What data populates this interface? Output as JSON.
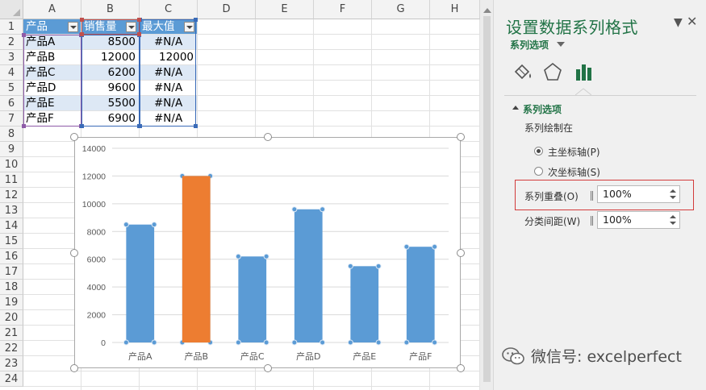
{
  "sheet": {
    "columns": [
      "A",
      "B",
      "C",
      "D",
      "E",
      "F",
      "G",
      "H"
    ],
    "rows": [
      "1",
      "2",
      "3",
      "4",
      "5",
      "6",
      "7",
      "8",
      "9",
      "10",
      "11",
      "12",
      "13",
      "14",
      "15",
      "16",
      "17",
      "18",
      "19",
      "20",
      "21",
      "22",
      "23",
      "24"
    ],
    "table": {
      "headers": [
        "产品",
        "销售量",
        "最大值"
      ],
      "rows": [
        [
          "产品A",
          "8500",
          "#N/A"
        ],
        [
          "产品B",
          "12000",
          "12000"
        ],
        [
          "产品C",
          "6200",
          "#N/A"
        ],
        [
          "产品D",
          "9600",
          "#N/A"
        ],
        [
          "产品E",
          "5500",
          "#N/A"
        ],
        [
          "产品F",
          "6900",
          "#N/A"
        ]
      ]
    }
  },
  "chart_data": {
    "type": "bar",
    "categories": [
      "产品A",
      "产品B",
      "产品C",
      "产品D",
      "产品E",
      "产品F"
    ],
    "series": [
      {
        "values": [
          8500,
          12000,
          6200,
          9600,
          5500,
          6900
        ],
        "color": "#5b9bd5"
      },
      {
        "values": [
          null,
          12000,
          null,
          null,
          null,
          null
        ],
        "color": "#ed7d31"
      }
    ],
    "ylim": [
      0,
      14000
    ],
    "yticks": [
      "0",
      "2000",
      "4000",
      "6000",
      "8000",
      "10000",
      "12000",
      "14000"
    ],
    "grid": true,
    "legend": "none",
    "overlap_percent": 100
  },
  "pane": {
    "title": "设置数据系列格式",
    "subtitle": "系列选项",
    "tabs": [
      "fill-line-icon",
      "effects-pentagon-icon",
      "series-options-bar-icon"
    ],
    "section": "系列选项",
    "plot_on_label": "系列绘制在",
    "primary_axis": "主坐标轴(P)",
    "secondary_axis": "次坐标轴(S)",
    "overlap_label": "系列重叠(O)",
    "overlap_value": "100%",
    "gap_label": "分类间距(W)",
    "gap_value": "100%",
    "accent": "#217346"
  },
  "watermark": {
    "text": "微信号: excelperfect"
  }
}
